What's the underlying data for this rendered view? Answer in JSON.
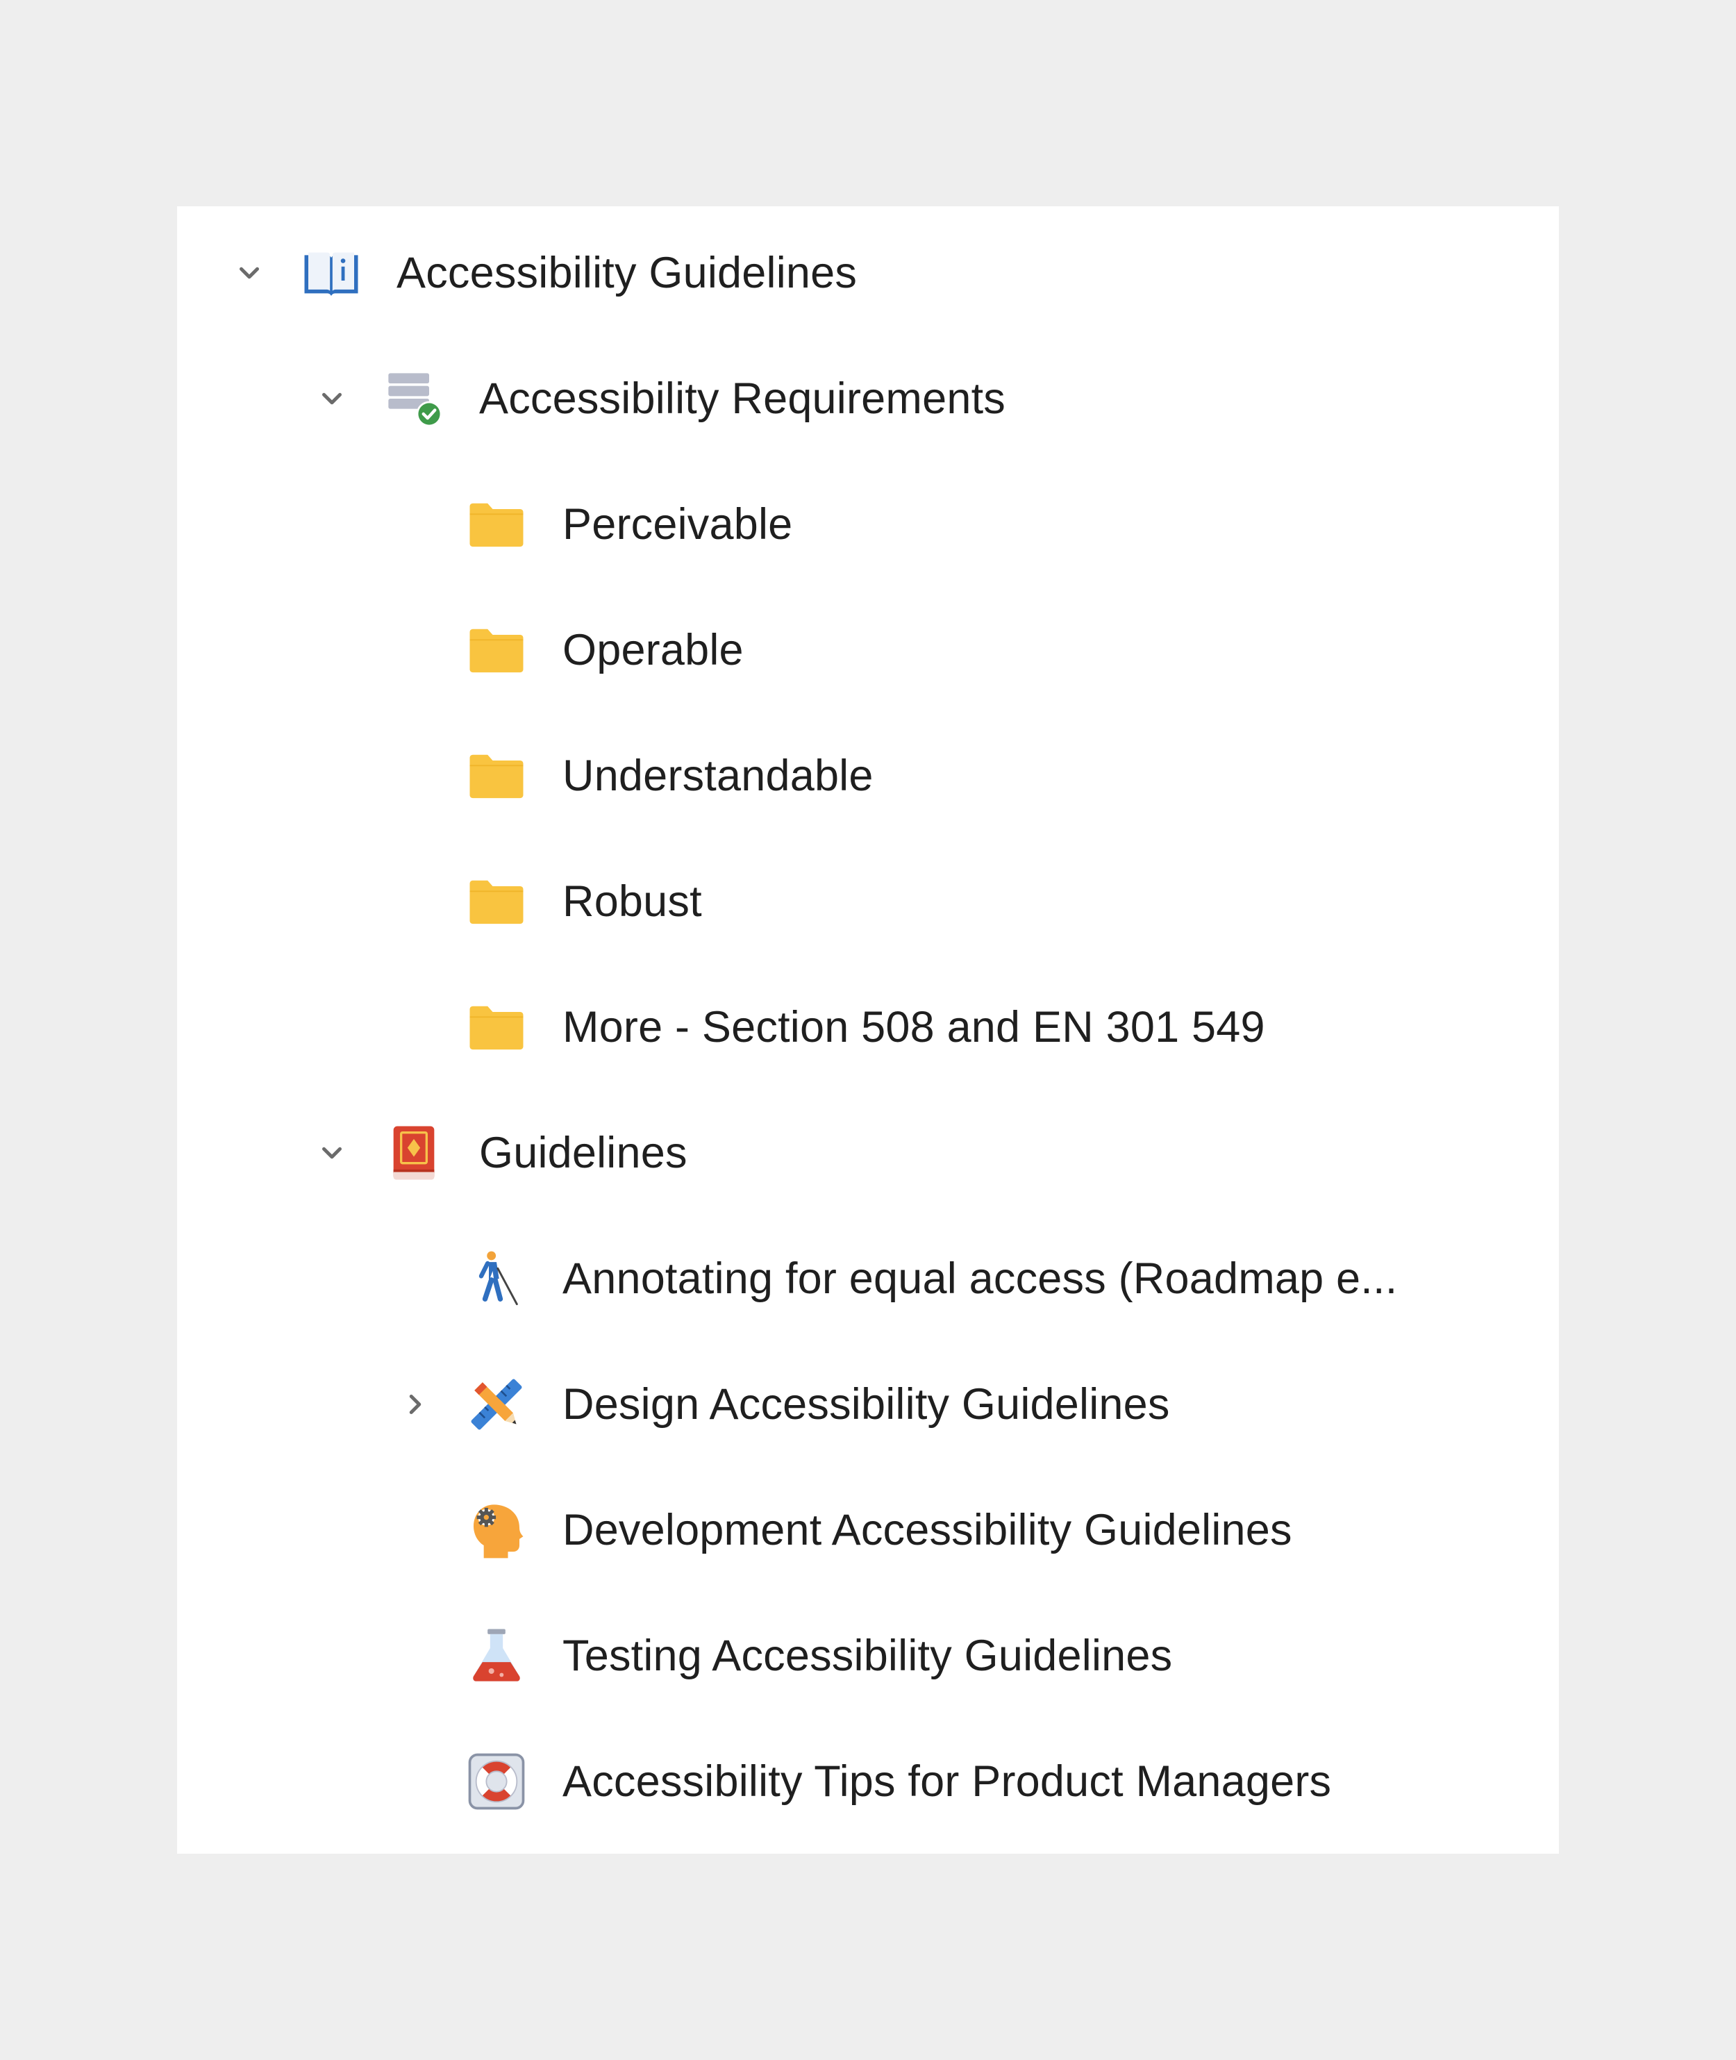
{
  "tree": {
    "root": {
      "label": "Accessibility Guidelines",
      "icon": "open-book-info-icon",
      "expanded": true
    },
    "requirements": {
      "label": "Accessibility Requirements",
      "icon": "database-check-icon",
      "expanded": true,
      "children": [
        {
          "label": "Perceivable",
          "icon": "folder-icon"
        },
        {
          "label": "Operable",
          "icon": "folder-icon"
        },
        {
          "label": "Understandable",
          "icon": "folder-icon"
        },
        {
          "label": "Robust",
          "icon": "folder-icon"
        },
        {
          "label": "More - Section 508 and EN 301 549",
          "icon": "folder-icon"
        }
      ]
    },
    "guidelines": {
      "label": "Guidelines",
      "icon": "red-book-icon",
      "expanded": true,
      "children": [
        {
          "label": "Annotating for equal access (Roadmap e...",
          "icon": "person-with-cane-icon"
        },
        {
          "label": "Design Accessibility Guidelines",
          "icon": "pencil-ruler-icon",
          "collapsed": true
        },
        {
          "label": "Development Accessibility Guidelines",
          "icon": "head-gear-icon"
        },
        {
          "label": "Testing Accessibility Guidelines",
          "icon": "flask-icon"
        },
        {
          "label": "Accessibility Tips for Product Managers",
          "icon": "lifebuoy-icon"
        }
      ]
    }
  },
  "colors": {
    "page_background": "#eeeeee",
    "panel_background": "#ffffff",
    "text": "#1f1f1f",
    "chevron": "#6b6b6b",
    "folder": "#f9c440",
    "book_blue": "#2f6fbf",
    "book_red": "#d9432f",
    "check_green": "#3f9b4a"
  }
}
